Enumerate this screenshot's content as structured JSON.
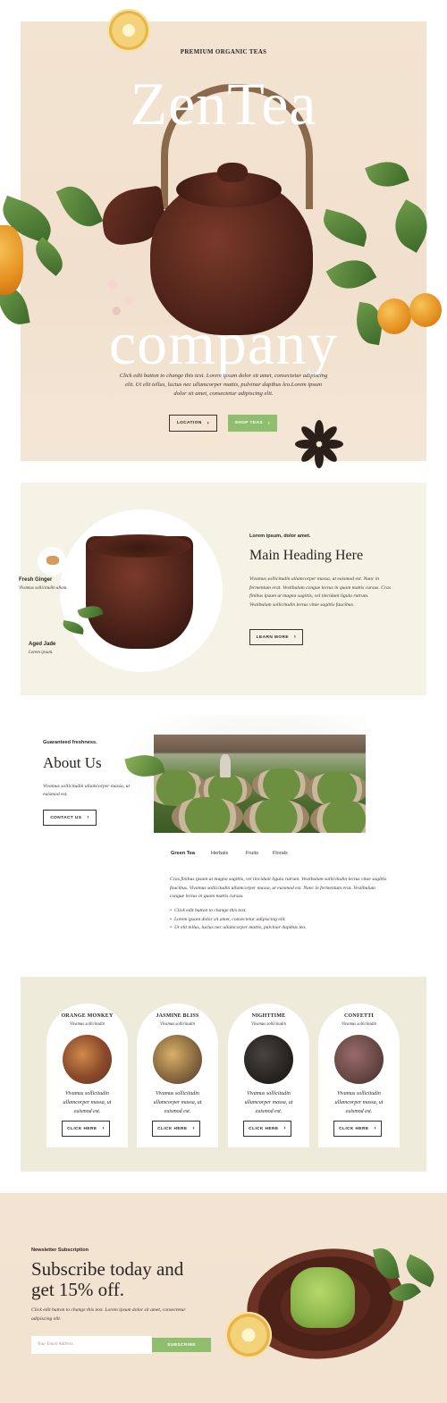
{
  "hero": {
    "eyebrow": "PREMIUM ORGANIC TEAS",
    "title_line1": "ZenTea",
    "title_line2": "company",
    "text": "Click edit button to change this text. Lorem ipsum dolor sit amet, consectetur adipiscing elit. Ut elit tellus, luctus nec ullamcorper mattis, pulvinar dapibus leo.Lorem ipsum dolor sit amet, consectetur adipiscing elit.",
    "location_label": "LOCATION",
    "shop_label": "SHOP TEAS"
  },
  "feature": {
    "ginger_title": "Fresh Ginger",
    "ginger_sub": "Vivamus sollicitudin ullam.",
    "jade_title": "Aged Jade",
    "jade_sub": "Lorem ipsum.",
    "eyebrow": "Lorem ipsum, dolor amet.",
    "heading": "Main Heading Here",
    "text": "Vivamus sollicitudin ullamcorper massa, ut euismod est. Nunc in fermentum erat. Vestibulum congue lectus in quam mattis cursus. Cras finibus ipsum ut magna sagittis, vel tincidunt ligula rutrum. Vestibulum sollicitudin lectus vitae sagittis faucibus.",
    "button_label": "LEARN MORE"
  },
  "about": {
    "eyebrow": "Guaranteed freshness.",
    "heading": "About Us",
    "text": "Vivamus sollicitudin ullamcorper massa, ut euismod est.",
    "button_label": "CONTACT US",
    "tabs": [
      "Green Tea",
      "Herbals",
      "Fruits",
      "Florals"
    ],
    "body": "Cras finibus ipsum ut magna sagittis, vel tincidunt ligula rutrum. Vestibulum sollicitudin lectus vitae sagittis faucibus. Vivamus sollicitudin ullamcorper massa, ut euismod est. Nunc in fermentum erat. Vestibulum congue lectus in quam mattis cursus.",
    "list": [
      "Click edit button to change this text.",
      "Lorem ipsum dolor sit amet, consectetur adipiscing elit.",
      "Ut elit tellus, luctus nec ullamcorper mattis, pulvinar dapibus leo."
    ]
  },
  "products": [
    {
      "name": "ORANGE MONKEY",
      "sub": "Vivamus sollicitudin",
      "text": "Vivamus sollicitudin ullamcorper massa, ut euismod est.",
      "button": "CLICK HERE",
      "color": "#b6643a"
    },
    {
      "name": "JASMINE BLISS",
      "sub": "Vivamus sollicitudin",
      "text": "Vivamus sollicitudin ullamcorper massa, ut euismod est.",
      "button": "CLICK HERE",
      "color": "#8a6a40"
    },
    {
      "name": "NIGHTTIME",
      "sub": "Vivamus sollicitudin",
      "text": "Vivamus sollicitudin ullamcorper massa, ut euismod est.",
      "button": "CLICK HERE",
      "color": "#2a2624"
    },
    {
      "name": "CONFETTI",
      "sub": "Vivamus sollicitudin",
      "text": "Vivamus sollicitudin ullamcorper massa, ut euismod est.",
      "button": "CLICK HERE",
      "color": "#6a4a44"
    }
  ],
  "newsletter": {
    "eyebrow": "Newsletter Subscription",
    "heading": "Subscribe today and get 15% off.",
    "text": "Click edit button to change this text. Lorem ipsum dolor sit amet, consectetur adipiscing elit.",
    "placeholder": "Your Email Address",
    "button_label": "SUBSCRIBE"
  },
  "colors": {
    "accent_green": "#8fbe6e",
    "text_dark": "#2a2422",
    "hero_bg": "#f3e3d1",
    "section_cream": "#f5f3e6",
    "teapot_brown": "#4b2118"
  }
}
